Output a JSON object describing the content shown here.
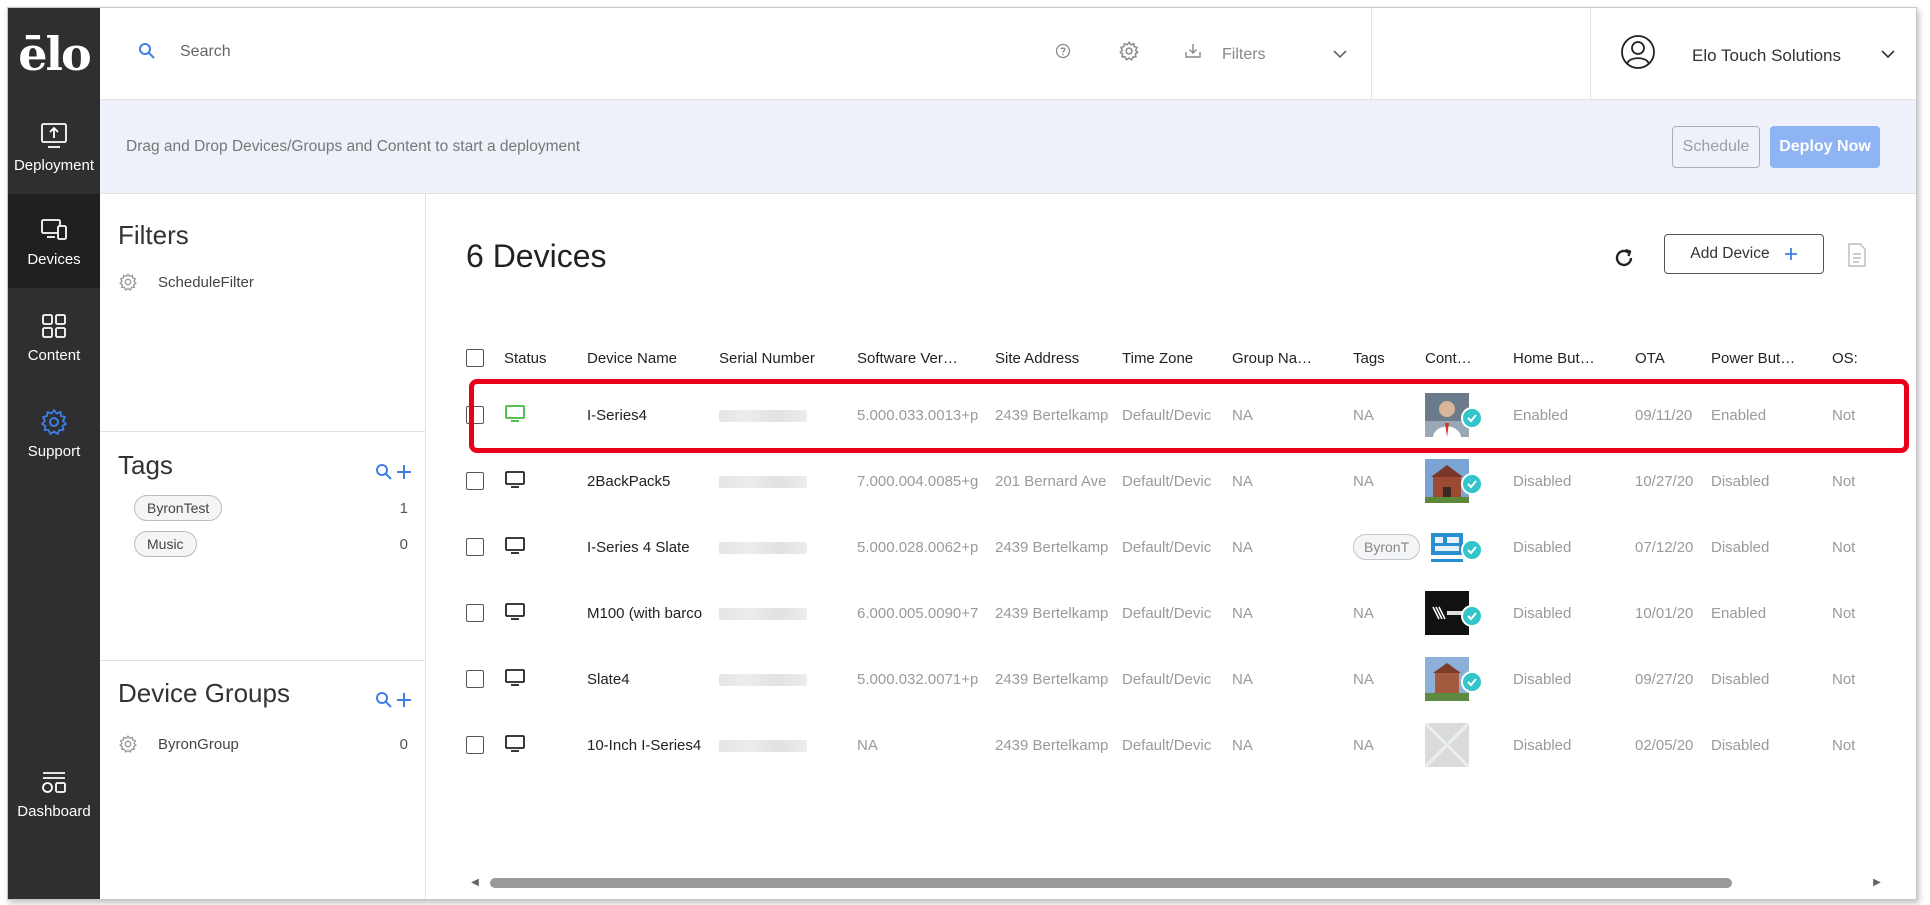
{
  "brand": {
    "logo_text": "ēlo"
  },
  "nav": {
    "items": [
      {
        "label": "Deployment",
        "icon": "deployment-icon"
      },
      {
        "label": "Devices",
        "icon": "devices-icon",
        "active": true
      },
      {
        "label": "Content",
        "icon": "content-grid-icon"
      },
      {
        "label": "Support",
        "icon": "gear-icon",
        "accent": "#3d7fe6"
      },
      {
        "label": "Dashboard",
        "icon": "dashboard-icon"
      }
    ]
  },
  "topbar": {
    "search_placeholder": "Search",
    "filters_label": "Filters",
    "org_name": "Elo Touch Solutions"
  },
  "banner": {
    "text": "Drag and Drop Devices/Groups and Content to start a deployment",
    "schedule_label": "Schedule",
    "deploy_label": "Deploy Now"
  },
  "side": {
    "filters_title": "Filters",
    "filters": [
      {
        "label": "ScheduleFilter"
      }
    ],
    "tags_title": "Tags",
    "tags": [
      {
        "label": "ByronTest",
        "count": "1"
      },
      {
        "label": "Music",
        "count": "0"
      }
    ],
    "groups_title": "Device Groups",
    "groups": [
      {
        "label": "ByronGroup",
        "count": "0"
      }
    ]
  },
  "main": {
    "title": "6 Devices",
    "add_device_label": "Add Device",
    "columns": [
      "Status",
      "Device Name",
      "Serial Number",
      "Software Ver…",
      "Site Address",
      "Time Zone",
      "Group Na…",
      "Tags",
      "Cont…",
      "Home But…",
      "OTA",
      "Power But…",
      "OS:"
    ],
    "rows": [
      {
        "status": "online",
        "name": "I-Series4",
        "software": "5.000.033.0013+p",
        "site": "2439 Bertelkamp",
        "tz": "Default/Devic",
        "group": "NA",
        "tags": "NA",
        "thumb": "person",
        "home": "Enabled",
        "ota": "09/11/20",
        "power": "Enabled",
        "os": "Not"
      },
      {
        "status": "offline",
        "name": "2BackPack5",
        "software": "7.000.004.0085+g",
        "site": "201 Bernard Ave",
        "tz": "Default/Devic",
        "group": "NA",
        "tags": "NA",
        "thumb": "church",
        "home": "Disabled",
        "ota": "10/27/20",
        "power": "Disabled",
        "os": "Not"
      },
      {
        "status": "offline",
        "name": "I-Series 4 Slate",
        "software": "5.000.028.0062+p",
        "site": "2439 Bertelkamp",
        "tz": "Default/Devic",
        "group": "NA",
        "tags": "ByronT",
        "thumb": "restaurant",
        "home": "Disabled",
        "ota": "07/12/20",
        "power": "Disabled",
        "os": "Not"
      },
      {
        "status": "offline",
        "name": "M100 (with barco",
        "software": "6.000.005.0090+7",
        "site": "2439 Bertelkamp",
        "tz": "Default/Devic",
        "group": "NA",
        "tags": "NA",
        "thumb": "zebra",
        "home": "Disabled",
        "ota": "10/01/20",
        "power": "Enabled",
        "os": "Not"
      },
      {
        "status": "offline",
        "name": "Slate4",
        "software": "5.000.032.0071+p",
        "site": "2439 Bertelkamp",
        "tz": "Default/Devic",
        "group": "NA",
        "tags": "NA",
        "thumb": "building",
        "home": "Disabled",
        "ota": "09/27/20",
        "power": "Disabled",
        "os": "Not"
      },
      {
        "status": "offline",
        "name": "10-Inch I-Series4",
        "software": "NA",
        "site": "2439 Bertelkamp",
        "tz": "Default/Devic",
        "group": "NA",
        "tags": "NA",
        "thumb": "placeholder",
        "home": "Disabled",
        "ota": "02/05/20",
        "power": "Disabled",
        "os": "Not"
      }
    ]
  },
  "colors": {
    "accent": "#3d7fe6",
    "online": "#3cb93c",
    "badge": "#32c5c9",
    "highlight": "#e8001a",
    "deploy_button": "#8fb4f3"
  }
}
